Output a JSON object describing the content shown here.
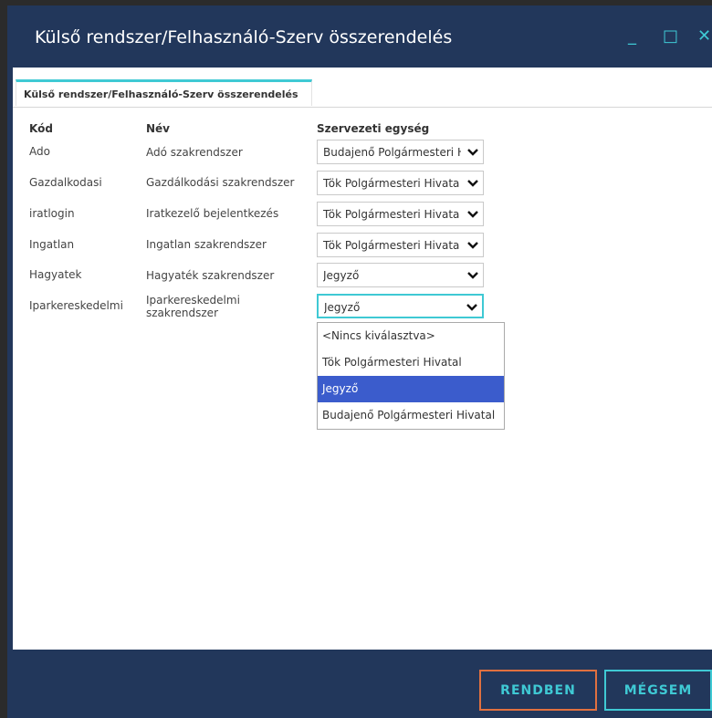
{
  "window": {
    "title": "Külső rendszer/Felhasználó-Szerv összerendelés",
    "min_glyph": "_",
    "max_glyph": "□",
    "close_glyph": "✕"
  },
  "tab": {
    "label": "Külső rendszer/Felhasználó-Szerv összerendelés"
  },
  "table": {
    "headers": {
      "code": "Kód",
      "name": "Név",
      "org": "Szervezeti egység"
    },
    "rows": [
      {
        "code": "Ado",
        "name": "Adó szakrendszer",
        "org": "Budajenő Polgármesteri H"
      },
      {
        "code": "Gazdalkodasi",
        "name": "Gazdálkodási szakrendszer",
        "org": "Tök Polgármesteri Hivata"
      },
      {
        "code": "iratlogin",
        "name": "Iratkezelő bejelentkezés",
        "org": "Tök Polgármesteri Hivata"
      },
      {
        "code": "Ingatlan",
        "name": "Ingatlan szakrendszer",
        "org": "Tök Polgármesteri Hivata"
      },
      {
        "code": "Hagyatek",
        "name": "Hagyaték szakrendszer",
        "org": "Jegyző"
      },
      {
        "code": "Iparkereskedelmi",
        "name": "Iparkereskedelmi szakrendszer",
        "org": "Jegyző"
      }
    ]
  },
  "dropdown": {
    "options": [
      "<Nincs kiválasztva>",
      "Tök Polgármesteri Hivatal",
      "Jegyző",
      "Budajenő Polgármesteri Hivatal"
    ],
    "highlighted": "Jegyző"
  },
  "footer": {
    "ok_label": "RENDBEN",
    "cancel_label": "MÉGSEM"
  },
  "colors": {
    "frame": "#22375b",
    "accent": "#3fc9d4",
    "ok_border": "#e07040",
    "highlight": "#3b5ccc"
  },
  "icons": [
    "minimize-icon",
    "maximize-icon",
    "close-icon",
    "chevron-down-icon"
  ]
}
